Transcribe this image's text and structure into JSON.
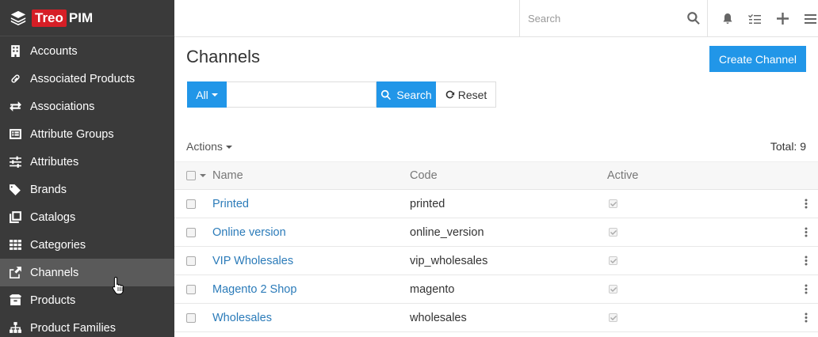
{
  "brand": {
    "treo": "Treo",
    "pim": "PIM"
  },
  "sidebar": {
    "items": [
      {
        "label": "Accounts",
        "icon": "building-icon"
      },
      {
        "label": "Associated Products",
        "icon": "link-icon"
      },
      {
        "label": "Associations",
        "icon": "exchange-icon"
      },
      {
        "label": "Attribute Groups",
        "icon": "list-box-icon"
      },
      {
        "label": "Attributes",
        "icon": "sliders-icon"
      },
      {
        "label": "Brands",
        "icon": "tags-icon"
      },
      {
        "label": "Catalogs",
        "icon": "catalog-icon"
      },
      {
        "label": "Categories",
        "icon": "grid-icon"
      },
      {
        "label": "Channels",
        "icon": "share-icon",
        "active": true
      },
      {
        "label": "Products",
        "icon": "box-icon"
      },
      {
        "label": "Product Families",
        "icon": "sitemap-icon"
      }
    ]
  },
  "topbar": {
    "search_placeholder": "Search"
  },
  "page": {
    "title": "Channels",
    "create_label": "Create Channel",
    "filter": {
      "all_label": "All",
      "search_label": "Search",
      "reset_label": "Reset"
    },
    "actions_label": "Actions",
    "total_label": "Total: 9"
  },
  "table": {
    "columns": {
      "name": "Name",
      "code": "Code",
      "active": "Active"
    },
    "rows": [
      {
        "name": "Printed",
        "code": "printed",
        "active": true
      },
      {
        "name": "Online version",
        "code": "online_version",
        "active": true
      },
      {
        "name": "VIP Wholesales",
        "code": "vip_wholesales",
        "active": true
      },
      {
        "name": "Magento 2 Shop",
        "code": "magento",
        "active": true
      },
      {
        "name": "Wholesales",
        "code": "wholesales",
        "active": true
      }
    ]
  },
  "colors": {
    "sidebar_bg": "#3a3a3a",
    "accent": "#2196e8",
    "brand_red": "#d61e26",
    "link": "#2b7bb9"
  }
}
